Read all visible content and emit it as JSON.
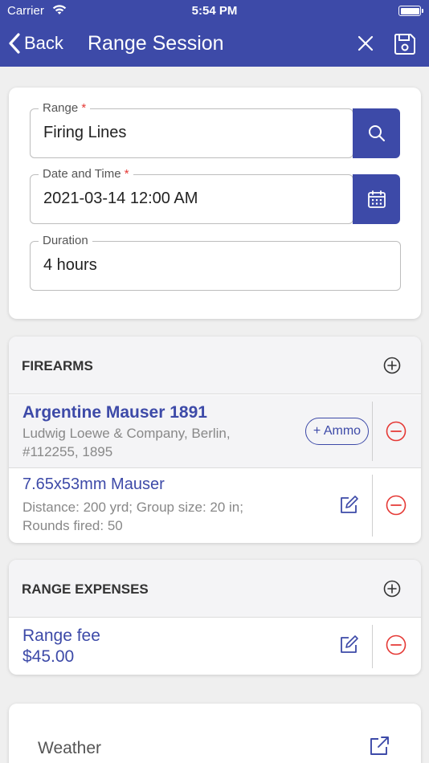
{
  "status_bar": {
    "carrier": "Carrier",
    "time": "5:54 PM"
  },
  "nav": {
    "back_label": "Back",
    "title": "Range Session"
  },
  "form": {
    "range": {
      "label": "Range",
      "value": "Firing Lines"
    },
    "datetime": {
      "label": "Date and Time",
      "value": "2021-03-14 12:00 AM"
    },
    "duration": {
      "label": "Duration",
      "value": "4 hours"
    },
    "required_mark": "*"
  },
  "firearms": {
    "header": "FIREARMS",
    "firearm": {
      "name": "Argentine Mauser 1891",
      "details_line1": "Ludwig Loewe & Company, Berlin,",
      "details_line2": "#112255, 1895",
      "ammo_button": "+ Ammo"
    },
    "ammo": {
      "name": "7.65x53mm Mauser",
      "details_line1": "Distance: 200 yrd; Group size: 20 in;",
      "details_line2": "Rounds fired: 50"
    }
  },
  "expenses": {
    "header": "RANGE EXPENSES",
    "item": {
      "name": "Range fee",
      "amount": "$45.00"
    }
  },
  "weather": {
    "label": "Weather"
  },
  "colors": {
    "primary": "#3d4aa8",
    "danger": "#e53935",
    "background": "#efefef"
  }
}
